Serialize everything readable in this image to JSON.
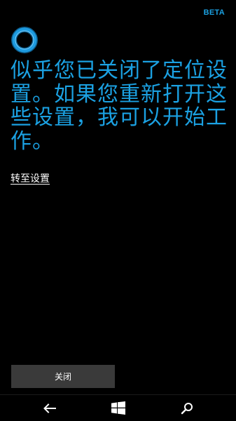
{
  "header": {
    "badge": "BETA"
  },
  "main": {
    "message": "似乎您已关闭了定位设置。如果您重新打开这些设置，我可以开始工作。",
    "settings_link": "转至设置",
    "close_button": "关闭"
  },
  "navbar": {
    "back_icon": "back-arrow-icon",
    "home_icon": "windows-logo-icon",
    "search_icon": "search-icon"
  },
  "colors": {
    "accent": "#1ba1e2",
    "beta": "#1ba1e2",
    "background": "#000000",
    "button": "#3a3a3a",
    "text": "#ffffff"
  }
}
